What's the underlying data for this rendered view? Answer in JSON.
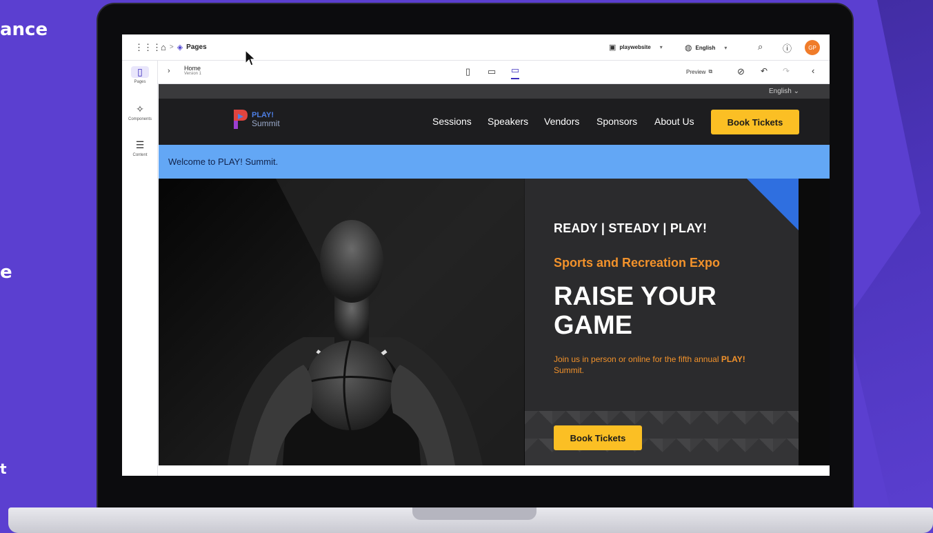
{
  "backdrop": {
    "side_text_1": "ance",
    "side_text_2": "e",
    "side_text_3": "t"
  },
  "topbar": {
    "apps_icon": "grid-icon",
    "home_icon": "home-icon",
    "breadcrumb_sep": ">",
    "pages_label": "Pages",
    "site_selector": "playwebsite",
    "language_selector": "English",
    "avatar_initials": "GP"
  },
  "rail": {
    "items": [
      {
        "label": "Pages",
        "icon": "page-icon"
      },
      {
        "label": "Components",
        "icon": "puzzle-icon"
      },
      {
        "label": "Content",
        "icon": "content-icon"
      }
    ]
  },
  "subbar": {
    "page_title": "Home",
    "page_version": "Version 1",
    "preview_label": "Preview"
  },
  "site": {
    "language": "English",
    "logo": {
      "line1": "PLAY!",
      "line2": "Summit"
    },
    "nav": [
      "Sessions",
      "Speakers",
      "Vendors",
      "Sponsors",
      "About Us"
    ],
    "nav_cta": "Book Tickets",
    "welcome": "Welcome to PLAY! Summit.",
    "hero": {
      "tagline": "READY | STEADY | PLAY!",
      "subhead": "Sports and Recreation Expo",
      "headline": "RAISE YOUR GAME",
      "desc_prefix": "Join us in person or online for the fifth annual",
      "desc_brand": "PLAY!",
      "desc_suffix": "Summit.",
      "cta": "Book Tickets"
    }
  },
  "colors": {
    "brand_purple": "#5b3fd0",
    "cta_yellow": "#fbbf24",
    "welcome_blue": "#63a7f5",
    "accent_orange": "#f2922b"
  }
}
